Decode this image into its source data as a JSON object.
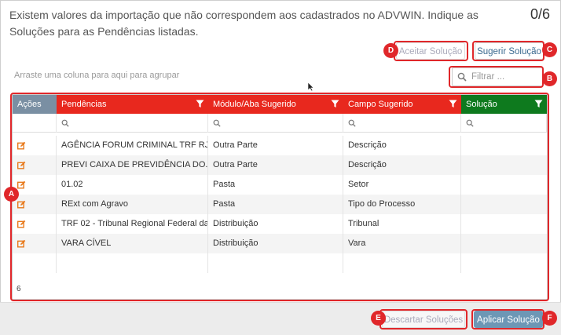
{
  "dialog": {
    "message": "Existem valores da importação que não correspondem aos cadastrados no ADVWIN. Indique as Soluções para as Pendências listadas.",
    "counter": "0/6"
  },
  "toolbar": {
    "aceitar_label": "Aceitar Solução",
    "sugerir_label": "Sugerir Solução"
  },
  "grid": {
    "group_hint": "Arraste uma coluna para aqui para agrupar",
    "filter_placeholder": "Filtrar ...",
    "columns": [
      {
        "label": "Ações",
        "color": "#7a8fa3"
      },
      {
        "label": "Pendências",
        "color": "#e8281e"
      },
      {
        "label": "Módulo/Aba Sugerido",
        "color": "#e8281e"
      },
      {
        "label": "Campo Sugerido",
        "color": "#e8281e"
      },
      {
        "label": "Solução",
        "color": "#0e7a1e"
      }
    ],
    "rows": [
      {
        "pendencia": "AGÊNCIA FORUM CRIMINAL TRF RJ",
        "modulo": "Outra Parte",
        "campo": "Descrição",
        "solucao": ""
      },
      {
        "pendencia": "PREVI CAIXA DE PREVIDÊNCIA DO...",
        "modulo": "Outra Parte",
        "campo": "Descrição",
        "solucao": ""
      },
      {
        "pendencia": "01.02",
        "modulo": "Pasta",
        "campo": "Setor",
        "solucao": ""
      },
      {
        "pendencia": "RExt com Agravo",
        "modulo": "Pasta",
        "campo": "Tipo do Processo",
        "solucao": ""
      },
      {
        "pendencia": "TRF 02 - Tribunal Regional Federal da...",
        "modulo": "Distribuição",
        "campo": "Tribunal",
        "solucao": ""
      },
      {
        "pendencia": "VARA CÍVEL",
        "modulo": "Distribuição",
        "campo": "Vara",
        "solucao": ""
      }
    ],
    "total_count": "6"
  },
  "footer": {
    "descartar_label": "Descartar Soluções",
    "aplicar_label": "Aplicar Solução"
  },
  "callouts": {
    "A": "A",
    "B": "B",
    "C": "C",
    "D": "D",
    "E": "E",
    "F": "F"
  },
  "colors": {
    "accent_red": "#e0272a",
    "header_red": "#e8281e",
    "header_green": "#0e7a1e",
    "primary_blue": "#6d97b5"
  }
}
